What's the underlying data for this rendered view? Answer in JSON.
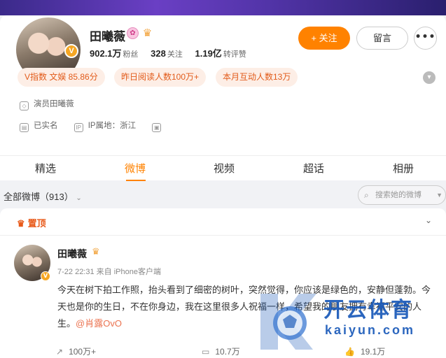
{
  "profile": {
    "name": "田曦薇",
    "verified_badge": "V",
    "followers_value": "902.1万",
    "followers_label": "粉丝",
    "following_value": "328",
    "following_label": "关注",
    "likes_value": "1.19亿",
    "likes_label": "转评赞",
    "follow_button": "+ 关注",
    "message_button": "留言",
    "more_button": "•••",
    "pills": [
      "V指数 文娱 85.86分",
      "昨日阅读人数100万+",
      "本月互动人数13万"
    ],
    "info_bio": "演员田曦薇",
    "info_realname": "已实名",
    "info_ip": "IP属地：浙江"
  },
  "tabs": [
    "精选",
    "微博",
    "视频",
    "超话",
    "相册"
  ],
  "active_tab": "微博",
  "filter": {
    "label": "全部微博（913）",
    "search_placeholder": "搜索她的微博"
  },
  "post": {
    "pinned_label": "置顶",
    "author": "田曦薇",
    "meta": "7-22 22:31  来自 iPhone客户端",
    "text_main": "今天在树下拍工作照，抬头看到了细密的树叶，突然觉得，你应该是绿色的，安静但蓬勃。今天也是你的生日，不在你身边，我在这里很多人祝福一样，希望我的朋友拥有幸福平安的人生。",
    "mention": "@肖露OvO",
    "repost_count": "100万+",
    "comment_count": "10.7万",
    "like_count": "19.1万"
  },
  "watermark": {
    "title": "开云体育",
    "subtitle": "kaiyun.com"
  },
  "colors": {
    "accent": "#ff8200",
    "pill_bg": "#fdeee6",
    "pill_text": "#e25b1a",
    "mention": "#eb7350"
  },
  "icons": {
    "more": "more-dots-icon",
    "search": "search-icon",
    "pin": "crown-icon"
  }
}
